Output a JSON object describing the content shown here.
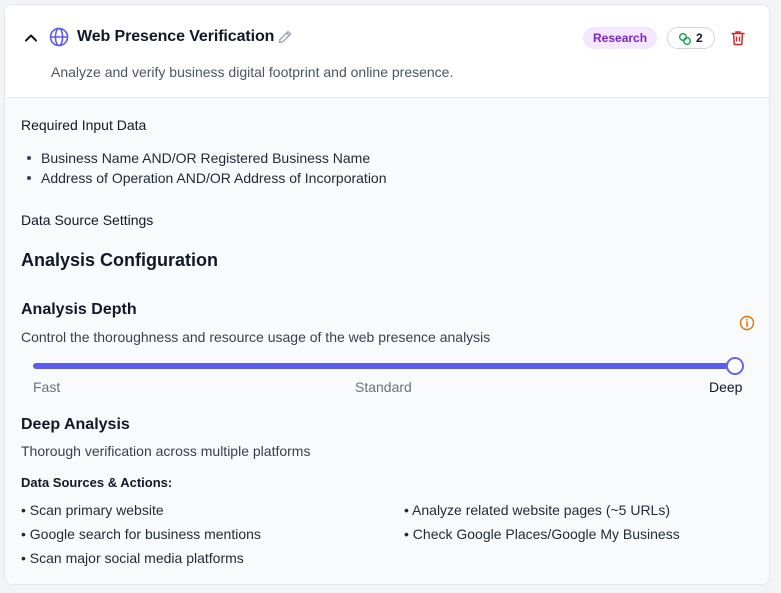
{
  "header": {
    "title": "Web Presence Verification",
    "description": "Analyze and verify business digital footprint and online presence.",
    "badge": "Research",
    "connection_count": "2"
  },
  "required_input": {
    "heading": "Required Input Data",
    "items": [
      "Business Name AND/OR Registered Business Name",
      "Address of Operation AND/OR Address of Incorporation"
    ]
  },
  "data_source_settings": {
    "heading": "Data Source Settings"
  },
  "analysis_config": {
    "heading": "Analysis Configuration",
    "depth_title": "Analysis Depth",
    "depth_description": "Control the thoroughness and resource usage of the web presence analysis",
    "slider": {
      "levels": [
        "Fast",
        "Standard",
        "Deep"
      ],
      "selected": "Deep",
      "value_fraction": 1.0
    }
  },
  "deep_analysis": {
    "title": "Deep Analysis",
    "description": "Thorough verification across multiple platforms",
    "sources_heading": "Data Sources & Actions:",
    "actions_left": [
      "Scan primary website",
      "Google search for business mentions",
      "Scan major social media platforms"
    ],
    "actions_right": [
      "Analyze related website pages (~5 URLs)",
      "Check Google Places/Google My Business"
    ]
  },
  "colors": {
    "accent": "#5b5bf0",
    "badge_bg": "#f3e8ff",
    "badge_text": "#7e22ce",
    "danger": "#dc2626",
    "connection_icon": "#16a34a",
    "info_icon": "#d97706"
  },
  "icons": [
    "chevron-up-icon",
    "globe-icon",
    "pencil-icon",
    "link-icon",
    "trash-icon",
    "info-icon"
  ]
}
